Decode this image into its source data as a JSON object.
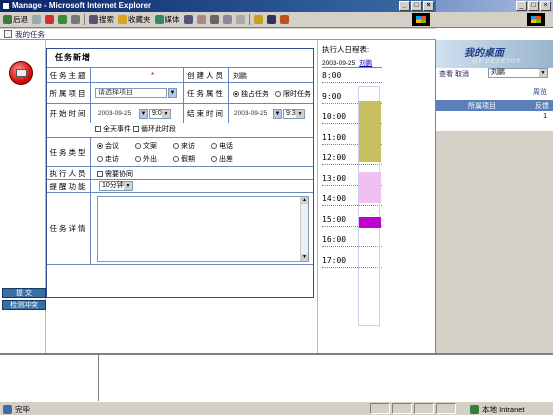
{
  "window": {
    "title": "Manage - Microsoft Internet Explorer"
  },
  "toolbar": {
    "back": "后退",
    "search": "搜索",
    "favorites": "收藏夹",
    "media": "媒体"
  },
  "tab": {
    "label": "我的任务"
  },
  "form": {
    "title": "任务新增",
    "subject_label": "任务主题",
    "subject_value": "",
    "required_star": "*",
    "creator_label": "创建人员",
    "creator_value": "刘鹏",
    "project_label": "所属项目",
    "project_placeholder": "请选择项目",
    "attr_label": "任务属性",
    "attr_options": [
      "独占任务",
      "限时任务"
    ],
    "attr_selected": 0,
    "start_label": "开始时间",
    "start_date": "2003-09-25",
    "start_time": "9:00",
    "end_label": "结束时间",
    "end_date": "2003-09-25",
    "end_time": "9:30",
    "allday_label": "全天事件",
    "repeat_label": "循环此时段",
    "type_label": "任务类型",
    "types": [
      "会议",
      "文案",
      "来访",
      "电话",
      "走访",
      "外出",
      "假期",
      "出差"
    ],
    "type_selected": 0,
    "executor_label": "执行人员",
    "collab_label": "需要协同",
    "remind_label": "提醒功能",
    "remind_value": "10分钟",
    "detail_label": "任务详情",
    "detail_value": ""
  },
  "sidebar_buttons": {
    "submit": "提 交",
    "check": "检测冲突"
  },
  "schedule": {
    "title": "执行人日程表:",
    "date": "2003-09-25",
    "person": "刘鹏",
    "hours": [
      "8:00",
      "9:00",
      "10:00",
      "11:00",
      "12:00",
      "13:00",
      "14:00",
      "15:00",
      "16:00",
      "17:00"
    ],
    "blocks": [
      {
        "start": 9.0,
        "end": 12.0,
        "color": "#c8c060"
      },
      {
        "start": 12.5,
        "end": 14.0,
        "color": "#f0c0f0"
      },
      {
        "start": 14.7,
        "end": 15.2,
        "color": "#c000d0"
      }
    ]
  },
  "background_window": {
    "banner": "我的桌面",
    "banner_sub": "MY DESKTOP",
    "tabs": [
      "查看",
      "取消"
    ],
    "select_value": "刘鹏",
    "link": "周览",
    "header_project": "所属项目",
    "header_feedback": "反馈",
    "row_value": "1"
  },
  "status": {
    "left": "完毕",
    "right": "本地 Intranet"
  },
  "colors": {
    "title_bar": "#0a246a",
    "form_border": "#334f8b",
    "button_blue": "#3a6ea5"
  }
}
